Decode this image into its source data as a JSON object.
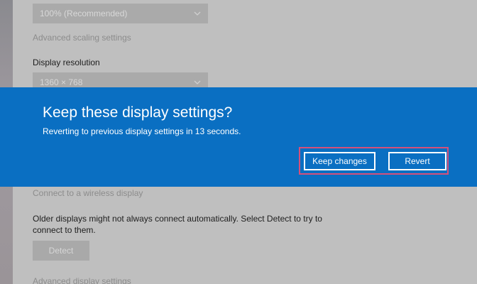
{
  "scale": {
    "selected": "100% (Recommended)",
    "advanced_link": "Advanced scaling settings"
  },
  "resolution": {
    "label": "Display resolution",
    "selected": "1360 × 768"
  },
  "dialog": {
    "title": "Keep these display settings?",
    "message": "Reverting to previous display settings in 13 seconds.",
    "keep_label": "Keep changes",
    "revert_label": "Revert",
    "accent_color": "#0a6fc2",
    "highlight_color": "#d6507a"
  },
  "wireless": {
    "link": "Connect to a wireless display"
  },
  "detect": {
    "description": "Older displays might not always connect automatically. Select Detect to try to connect to them.",
    "button_label": "Detect"
  },
  "advanced_display": {
    "link": "Advanced display settings"
  }
}
